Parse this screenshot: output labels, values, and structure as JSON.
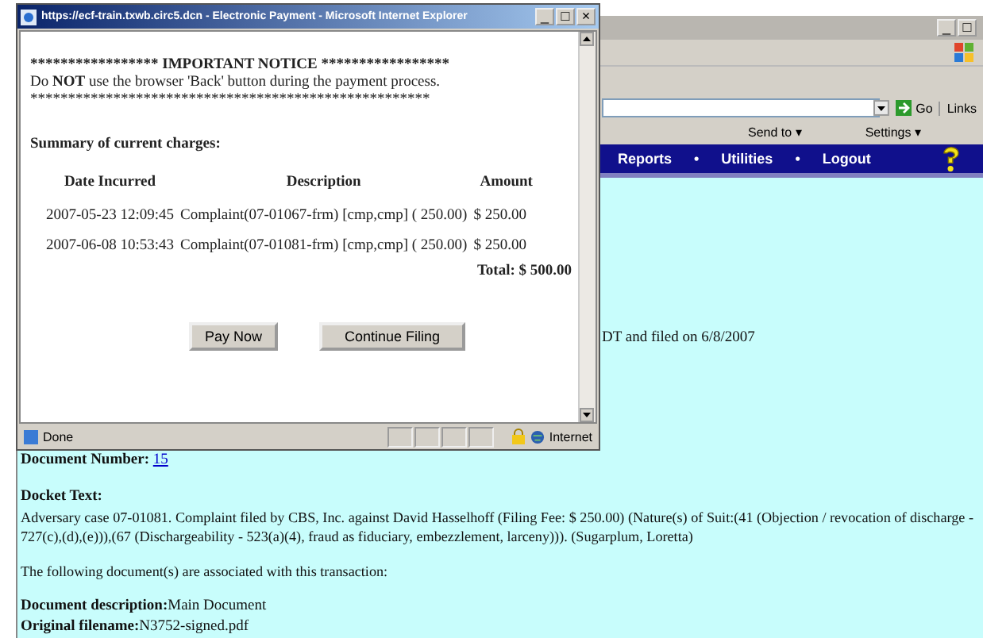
{
  "popup": {
    "title": "https://ecf-train.txwb.circ5.dcn - Electronic Payment - Microsoft Internet Explorer",
    "window_controls": [
      "_",
      "□",
      "×"
    ],
    "notice_banner": "***************** IMPORTANT NOTICE *****************",
    "notice_text": "Do **NOT** use the browser 'Back' button during the payment process.",
    "notice_rule": "*****************************************************",
    "summary_title": "Summary of current charges:",
    "table": {
      "columns": [
        "Date Incurred",
        "Description",
        "Amount"
      ],
      "rows": [
        [
          "2007-05-23 12:09:45",
          "Complaint(07-01067-frm) [cmp,cmp] ( 250.00)",
          "$ 250.00"
        ],
        [
          "2007-06-08 10:53:43",
          "Complaint(07-01081-frm) [cmp,cmp] ( 250.00)",
          "$ 250.00"
        ]
      ]
    },
    "total": "Total: $ 500.00",
    "buttons": [
      "Pay Now",
      "Continue Filing"
    ],
    "status_bar": {
      "text": "Done",
      "zone": "Internet"
    }
  },
  "browser": {
    "window_controls": [
      "_",
      "□"
    ],
    "address_bar": {
      "go": "Go",
      "links": "Links"
    },
    "toolbar": [
      "Send to ▾",
      "Settings ▾"
    ],
    "nav": [
      "Reports",
      "•",
      "Utilities",
      "•",
      "Logout"
    ]
  },
  "page": {
    "filed_line": "DT and filed on 6/8/2007",
    "document_number": {
      "label": "Document Number:",
      "value": "15"
    },
    "docket_label": "Docket Text:",
    "docket_text": "Adversary case 07-01081. Complaint filed by CBS, Inc. against David Hasselhoff (Filing Fee: $ 250.00) (Nature(s) of Suit:(41 (Objection / revocation of discharge - 727(c),(d),(e))),(67 (Dischargeability - 523(a)(4), fraud as fiduciary, embezzlement, larceny))). (Sugarplum, Loretta)",
    "associated": "The following document(s) are associated with this transaction:",
    "fields": [
      {
        "label": "Document description:",
        "value": "Main Document"
      },
      {
        "label": "Original filename:",
        "value": "N3752-signed.pdf"
      }
    ]
  }
}
